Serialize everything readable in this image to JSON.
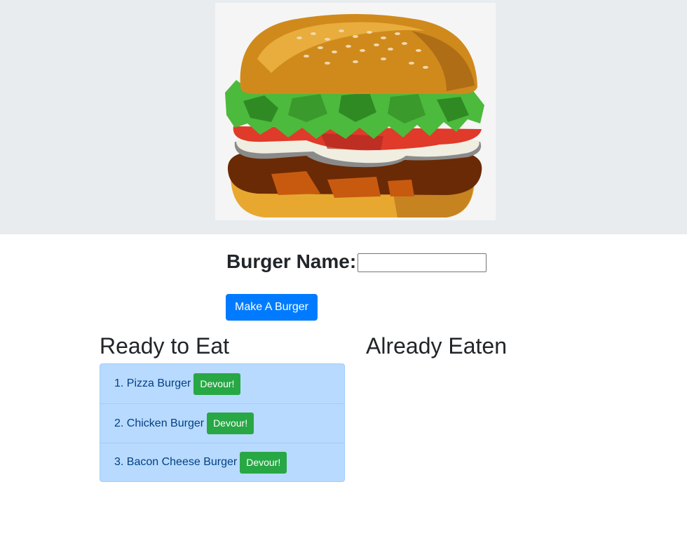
{
  "hero": {
    "image_icon": "hamburger-illustration",
    "background": "#e9ecef"
  },
  "form": {
    "label": "Burger Name:",
    "input_value": "",
    "input_placeholder": "",
    "submit_label": "Make A Burger"
  },
  "columns": {
    "ready_heading": "Ready to Eat",
    "eaten_heading": "Already Eaten"
  },
  "ready_list": [
    {
      "label": "1. Pizza Burger",
      "button": "Devour!"
    },
    {
      "label": "2. Chicken Burger",
      "button": "Devour!"
    },
    {
      "label": "3. Bacon Cheese Burger",
      "button": "Devour!"
    }
  ],
  "eaten_list": [],
  "colors": {
    "primary": "#007bff",
    "success": "#28a745",
    "list_bg": "#b8daff",
    "list_text": "#004085"
  }
}
